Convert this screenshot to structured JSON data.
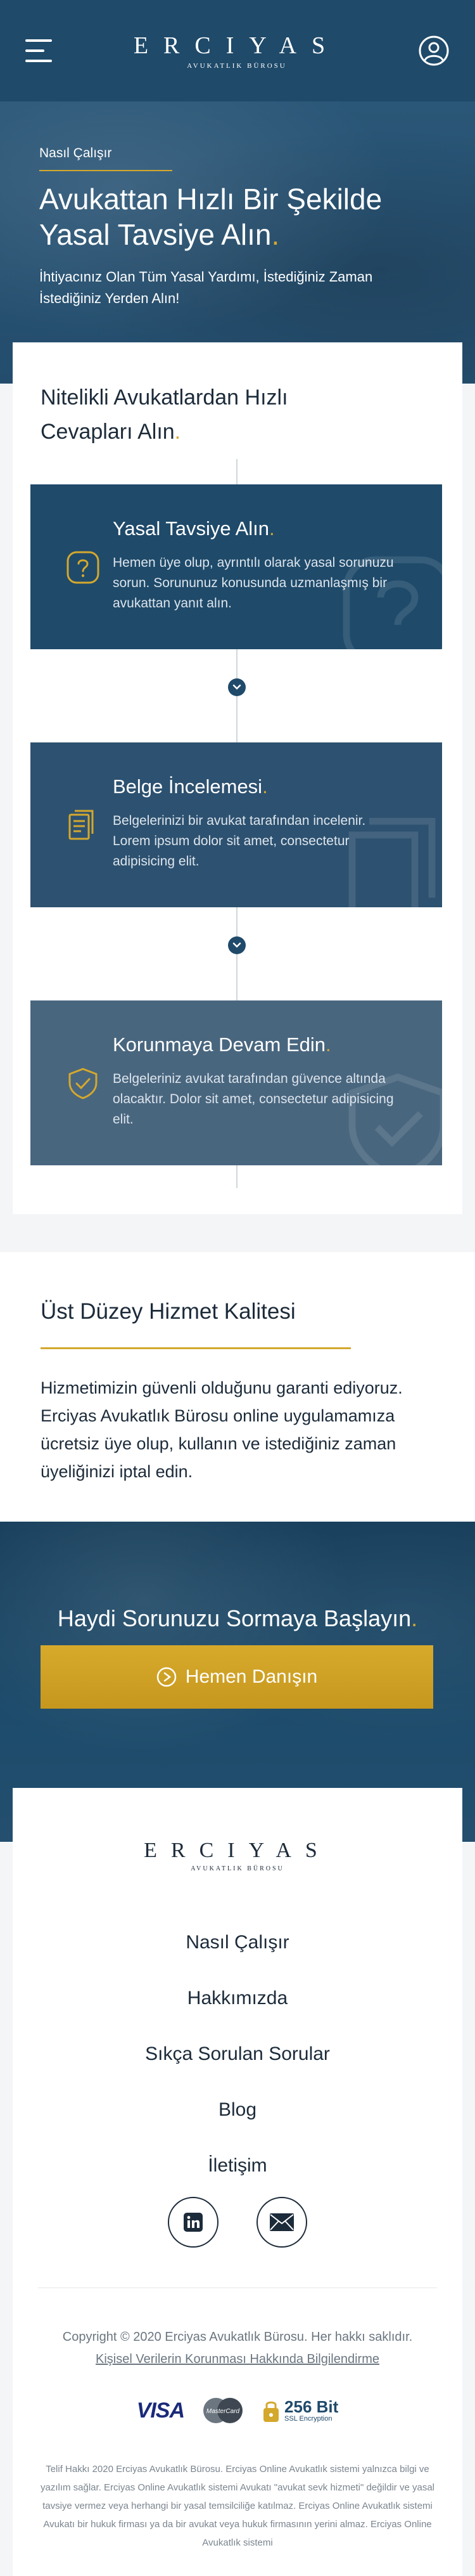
{
  "header": {
    "logo_word": "ERCIYAS",
    "logo_sub": "AVUKATLIK BÜROSU",
    "menu_icon": "hamburger-menu-icon",
    "account_icon": "user-circle-icon"
  },
  "hero": {
    "kicker": "Nasıl Çalışır",
    "title": "Avukattan Hızlı Bir Şekilde Yasal Tavsiye Alın",
    "title_dot": ".",
    "subtitle": "İhtiyacınız Olan Tüm Yasal Yardımı, İstediğiniz Zaman İstediğiniz Yerden Alın!"
  },
  "steps": {
    "title": "Nitelikli Avukatlardan Hızlı Cevapları Alın",
    "title_dot": ".",
    "items": [
      {
        "title": "Yasal Tavsiye Alın",
        "dot": ".",
        "text": "Hemen üye olup, ayrıntılı olarak yasal sorunuzu sorun. Sorununuz konusunda uzmanlaşmış bir avukattan yanıt alın.",
        "icon": "question-icon"
      },
      {
        "title": "Belge İncelemesi",
        "dot": ".",
        "text": "Belgelerinizi bir avukat tarafından incelenir. Lorem ipsum dolor sit amet, consectetur adipisicing elit.",
        "icon": "documents-icon"
      },
      {
        "title": "Korunmaya Devam Edin",
        "dot": ".",
        "text": "Belgeleriniz avukat tarafından güvence altında olacaktır. Dolor sit amet, consectetur adipisicing elit.",
        "icon": "shield-check-icon"
      }
    ]
  },
  "quality": {
    "title": "Üst Düzey Hizmet Kalitesi",
    "text": "Hizmetimizin güvenli olduğunu garanti ediyoruz. Erciyas Avukatlık Bürosu online uygulamamıza ücretsiz üye olup, kullanın ve istediğiniz zaman üyeliğinizi iptal edin."
  },
  "cta": {
    "title": "Haydi Sorunuzu Sormaya Başlayın",
    "title_dot": ".",
    "button_label": "Hemen Danışın"
  },
  "footer": {
    "logo_word": "ERCIYAS",
    "logo_sub": "AVUKATLIK BÜROSU",
    "nav": [
      "Nasıl Çalışır",
      "Hakkımızda",
      "Sıkça Sorulan Sorular",
      "Blog",
      "İletişim"
    ],
    "socials": [
      "linkedin-icon",
      "mail-icon"
    ],
    "copyright": "Copyright © 2020 Erciyas Avukatlık Bürosu. Her hakkı saklıdır.",
    "kvkk_link": "Kişisel Verilerin Korunması Hakkında Bilgilendirme",
    "payment": {
      "visa": "VISA",
      "mastercard": "MasterCard",
      "ssl_big": "256 Bit",
      "ssl_small": "SSL Encryption"
    },
    "legal": "Telif Hakkı 2020 Erciyas Avukatlık Bürosu. Erciyas Online Avukatlık sistemi yalnızca bilgi ve yazılım sağlar. Erciyas Online Avukatlık sistemi Avukatı \"avukat sevk hizmeti\" değildir ve yasal tavsiye vermez veya herhangi bir yasal temsilciliğe katılmaz. Erciyas Online Avukatlık sistemi Avukatı bir hukuk firması ya da bir avukat veya hukuk firmasının yerini almaz. Erciyas Online Avukatlık sistemi"
  },
  "colors": {
    "primary": "#1f4a6a",
    "accent": "#d4a82d"
  }
}
